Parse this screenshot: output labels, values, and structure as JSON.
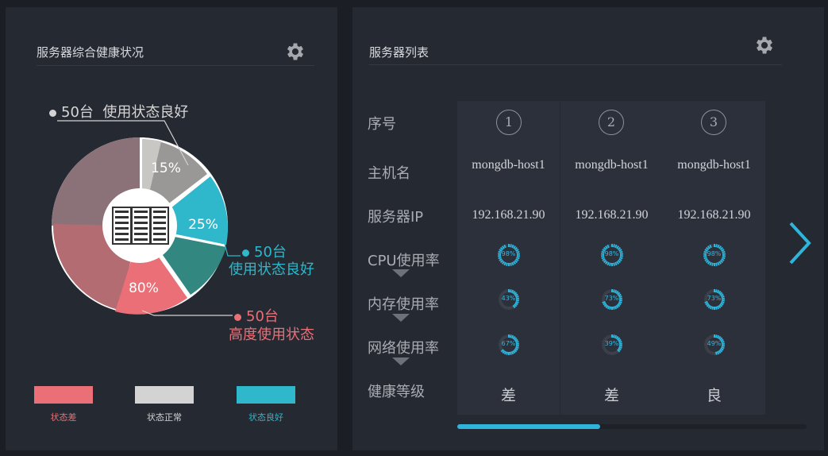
{
  "colors": {
    "bad": "#ea6f77",
    "normal": "#d3d3d3",
    "good": "#2fb7cb",
    "blue": "#2fb4db"
  },
  "health_panel": {
    "title": "服务器综合健康状况",
    "settings_icon": "gear-icon",
    "center_icon": "server-rack-icon",
    "slices": [
      {
        "label": "15%",
        "value": 15,
        "category": "normal"
      },
      {
        "label": "25%",
        "value": 25,
        "category": "good"
      },
      {
        "label": "80%",
        "value": 80,
        "category": "bad"
      }
    ],
    "callouts": [
      {
        "count": "50台",
        "text": "使用状态良好",
        "category": "normal"
      },
      {
        "count": "50台",
        "text": "使用状态良好",
        "category": "good"
      },
      {
        "count": "50台",
        "text": "高度使用状态",
        "category": "bad"
      }
    ],
    "legend": [
      {
        "label": "状态差",
        "category": "bad"
      },
      {
        "label": "状态正常",
        "category": "normal"
      },
      {
        "label": "状态良好",
        "category": "good"
      }
    ]
  },
  "server_list": {
    "title": "服务器列表",
    "settings_icon": "gear-icon",
    "row_labels": {
      "index": "序号",
      "hostname": "主机名",
      "ip": "服务器IP",
      "cpu": "CPU使用率",
      "memory": "内存使用率",
      "network": "网络使用率",
      "health": "健康等级"
    },
    "servers": [
      {
        "index": "1",
        "hostname": "mongdb-host1",
        "ip": "192.168.21.90",
        "cpu": 98,
        "cpu_label": "98%",
        "memory": 43,
        "memory_label": "43%",
        "network": 67,
        "network_label": "67%",
        "health": "差"
      },
      {
        "index": "2",
        "hostname": "mongdb-host1",
        "ip": "192.168.21.90",
        "cpu": 98,
        "cpu_label": "98%",
        "memory": 73,
        "memory_label": "73%",
        "network": 39,
        "network_label": "39%",
        "health": "差"
      },
      {
        "index": "3",
        "hostname": "mongdb-host1",
        "ip": "192.168.21.90",
        "cpu": 98,
        "cpu_label": "98%",
        "memory": 73,
        "memory_label": "73%",
        "network": 49,
        "network_label": "49%",
        "health": "良"
      }
    ],
    "scroll_progress": 0.41,
    "next_icon": "chevron-right-icon"
  }
}
